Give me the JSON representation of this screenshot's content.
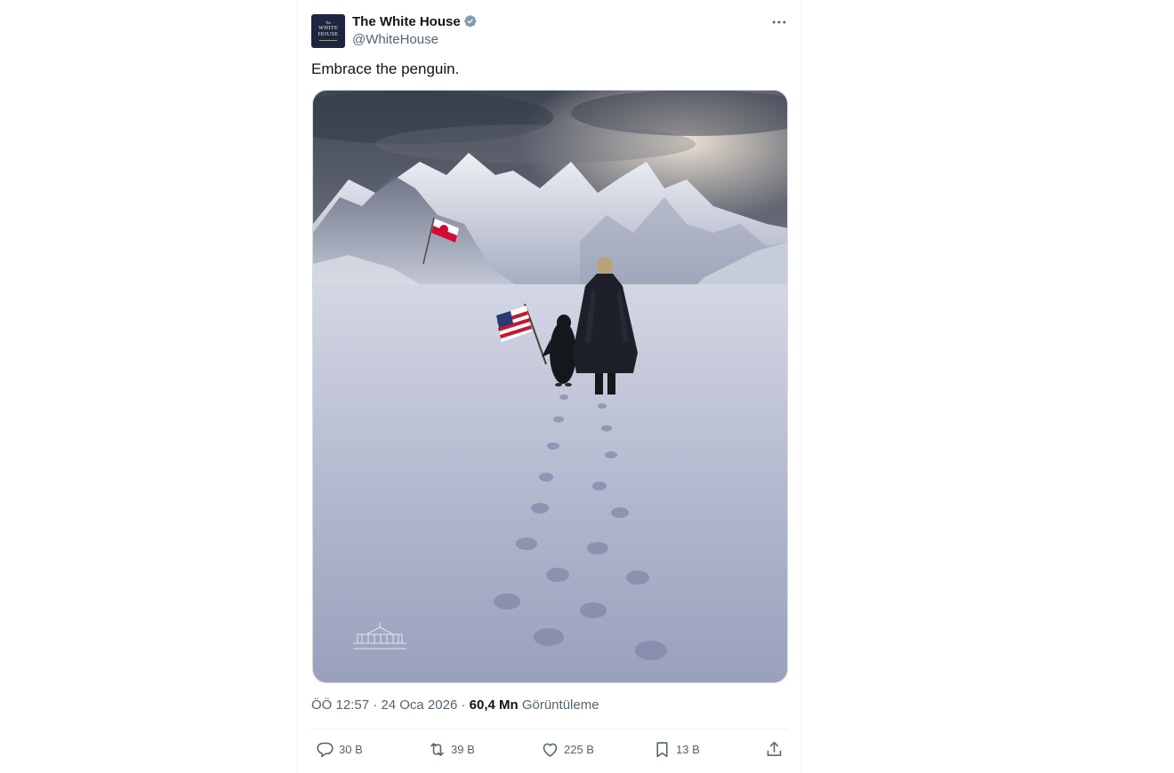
{
  "post": {
    "author": {
      "name": "The White House",
      "handle": "@WhiteHouse",
      "verified": true,
      "avatar_text": [
        "The",
        "WHITE",
        "HOUSE"
      ]
    },
    "text": "Embrace the penguin.",
    "media": {
      "description_icon": "photo"
    },
    "meta": {
      "time": "ÖÖ 12:57",
      "sep1": " · ",
      "date": "24 Oca 2026",
      "sep2": " · ",
      "views_count": "60,4 Mn",
      "views_label": " Görüntüleme"
    },
    "actions": {
      "replies": "30 B",
      "reposts": "39 B",
      "likes": "225 B",
      "bookmarks": "13 B"
    }
  },
  "icons": {
    "more": "more-horizontal-icon",
    "reply": "reply-icon",
    "repost": "repost-icon",
    "like": "heart-icon",
    "bookmark": "bookmark-icon",
    "share": "share-icon"
  },
  "colors": {
    "verified": "#829aab",
    "text_secondary": "#536471",
    "border": "#eff3f4"
  }
}
